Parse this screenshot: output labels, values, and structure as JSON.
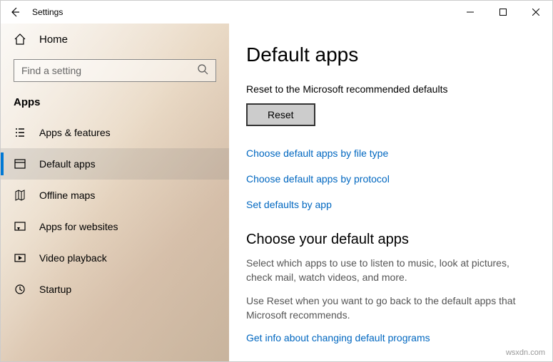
{
  "titlebar": {
    "title": "Settings"
  },
  "sidebar": {
    "home_label": "Home",
    "search_placeholder": "Find a setting",
    "section": "Apps",
    "items": [
      {
        "label": "Apps & features"
      },
      {
        "label": "Default apps"
      },
      {
        "label": "Offline maps"
      },
      {
        "label": "Apps for websites"
      },
      {
        "label": "Video playback"
      },
      {
        "label": "Startup"
      }
    ]
  },
  "content": {
    "page_title": "Default apps",
    "reset_heading": "Reset to the Microsoft recommended defaults",
    "reset_button": "Reset",
    "links": [
      "Choose default apps by file type",
      "Choose default apps by protocol",
      "Set defaults by app"
    ],
    "choose_title": "Choose your default apps",
    "choose_body1": "Select which apps to use to listen to music, look at pictures, check mail, watch videos, and more.",
    "choose_body2": "Use Reset when you want to go back to the default apps that Microsoft recommends.",
    "info_link": "Get info about changing default programs"
  },
  "watermark": "wsxdn.com"
}
